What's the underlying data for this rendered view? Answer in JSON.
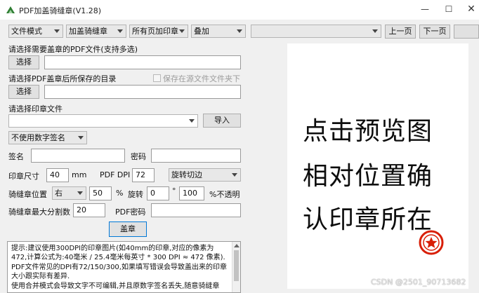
{
  "window": {
    "title": "PDF加盖骑缝章(V1.28)",
    "minimize": "—",
    "maximize": "☐",
    "close": "✕"
  },
  "toolbar": {
    "mode_select": "文件模式",
    "stamp_type_select": "加盖骑缝章",
    "pages_select": "所有页加印章",
    "overlay_select": "叠加",
    "preview_file_select": "",
    "prev_page": "上一页",
    "next_page": "下一页"
  },
  "pdf_section": {
    "label": "请选择需要盖章的PDF文件(支持多选)",
    "select_button": "选择",
    "path_value": ""
  },
  "output_section": {
    "label": "请选择PDF盖章后所保存的目录",
    "save_in_source_label": "保存在源文件文件夹下",
    "save_in_source_checked": false,
    "select_button": "选择",
    "path_value": ""
  },
  "seal_section": {
    "label": "请选择印章文件",
    "seal_file_select": "",
    "import_button": "导入"
  },
  "signature": {
    "mode_select": "不使用数字签名",
    "signer_label": "签名",
    "signer_value": "",
    "password_label": "密码",
    "password_value": ""
  },
  "settings": {
    "seal_size_label": "印章尺寸",
    "seal_size_value": "40",
    "seal_size_unit": "mm",
    "pdf_dpi_label": "PDF DPI",
    "pdf_dpi_value": "72",
    "rotate_edge_select": "旋转切边",
    "position_label": "骑缝章位置",
    "position_select": "右",
    "position_value": "50",
    "percent_sign": "%",
    "rotation_label": "旋转",
    "rotation_value": "0",
    "degree_sign": "°",
    "opacity_value": "100",
    "opacity_label": "%不透明",
    "max_split_label": "骑缝章最大分割数",
    "max_split_value": "20",
    "pdf_password_label": "PDF密码",
    "pdf_password_value": ""
  },
  "actions": {
    "stamp_button": "盖章"
  },
  "tips": {
    "text": "提示:建议使用300DPI的印章图片(如40mm的印章,对应的像素为472,计算公式为:40毫米 / 25.4毫米每英寸 * 300 DPI ≈ 472 像素).\nPDF文件常见的DPI有72/150/300,如果填写错误会导致盖出来的印章大小跟实际有差异.\n使用合并模式会导致文字不可编辑,并且原数字签名丢失,随意骑缝章"
  },
  "preview": {
    "lines": [
      "点击预览图",
      "相对位置确",
      "认印章所在"
    ]
  },
  "watermark": "CSDN @2501_90713682",
  "colors": {
    "seal_red": "#d81e06",
    "focus_blue": "#0078d7"
  }
}
